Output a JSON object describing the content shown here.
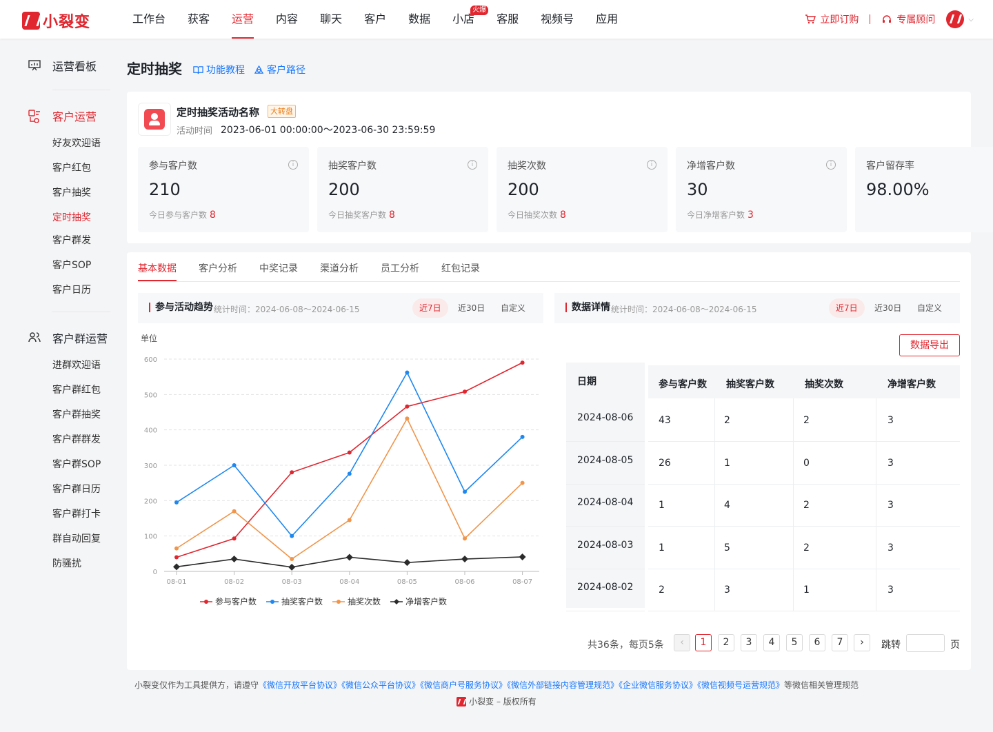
{
  "app": {
    "logo_text": "小裂变"
  },
  "nav": {
    "items": [
      {
        "label": "工作台"
      },
      {
        "label": "获客"
      },
      {
        "label": "运营",
        "active": true
      },
      {
        "label": "内容"
      },
      {
        "label": "聊天"
      },
      {
        "label": "客户"
      },
      {
        "label": "数据"
      },
      {
        "label": "小店",
        "badge": "火爆"
      },
      {
        "label": "客服"
      },
      {
        "label": "视频号"
      },
      {
        "label": "应用"
      }
    ]
  },
  "top_right": {
    "order_label": "立即订购",
    "advisor_label": "专属顾问"
  },
  "sidebar": {
    "board_label": "运营看板",
    "customer_ops": {
      "label": "客户运营",
      "items": [
        "好友欢迎语",
        "客户红包",
        "客户抽奖",
        "定时抽奖",
        "客户群发",
        "客户SOP",
        "客户日历"
      ]
    },
    "group_ops": {
      "label": "客户群运营",
      "items": [
        "进群欢迎语",
        "客户群红包",
        "客户群抽奖",
        "客户群群发",
        "客户群SOP",
        "客户群日历",
        "客户群打卡",
        "群自动回复",
        "防骚扰"
      ]
    }
  },
  "page": {
    "title": "定时抽奖",
    "tutorial_label": "功能教程",
    "path_label": "客户路径"
  },
  "activity": {
    "name": "定时抽奖活动名称",
    "tag": "大转盘",
    "time_label": "活动时间",
    "time_range": "2023-06-01 00:00:00～2023-06-30 23:59:59"
  },
  "stats": [
    {
      "label": "参与客户数",
      "value": "210",
      "sub_label": "今日参与客户数",
      "sub_value": "8",
      "info": true
    },
    {
      "label": "抽奖客户数",
      "value": "200",
      "sub_label": "今日抽奖客户数",
      "sub_value": "8",
      "info": true
    },
    {
      "label": "抽奖次数",
      "value": "200",
      "sub_label": "今日抽奖次数",
      "sub_value": "8",
      "info": true
    },
    {
      "label": "净增客户数",
      "value": "30",
      "sub_label": "今日净增客户数",
      "sub_value": "3",
      "info": true
    },
    {
      "label": "客户留存率",
      "value": "98.00%",
      "sub_label": "",
      "sub_value": "",
      "info": false
    }
  ],
  "tabs": [
    "基本数据",
    "客户分析",
    "中奖记录",
    "渠道分析",
    "员工分析",
    "红包记录"
  ],
  "trend_section": {
    "title": "参与活动趋势",
    "time_text": "统计时间：2024-06-08～2024-06-15",
    "ranges": [
      "近7日",
      "近30日",
      "自定义"
    ],
    "unit_label": "单位"
  },
  "detail_section": {
    "title": "数据详情",
    "time_text": "统计时间：2024-06-08～2024-06-15",
    "ranges": [
      "近7日",
      "近30日",
      "自定义"
    ],
    "export_label": "数据导出"
  },
  "chart_data": {
    "type": "line",
    "x": [
      "08-01",
      "08-02",
      "08-03",
      "08-04",
      "08-05",
      "08-06",
      "08-07"
    ],
    "ylim": [
      0,
      600
    ],
    "yticks": [
      0,
      100,
      200,
      300,
      400,
      500,
      600
    ],
    "grid": true,
    "legend": "bottom",
    "ylabel": "单位",
    "series": [
      {
        "name": "参与客户数",
        "color": "#e0262f",
        "marker": "circle",
        "values": [
          40,
          93,
          280,
          336,
          466,
          508,
          590
        ]
      },
      {
        "name": "抽奖客户数",
        "color": "#1e88f0",
        "marker": "circle",
        "values": [
          195,
          300,
          100,
          276,
          562,
          225,
          380
        ]
      },
      {
        "name": "抽奖次数",
        "color": "#f0954a",
        "marker": "circle",
        "values": [
          65,
          170,
          35,
          145,
          432,
          93,
          250
        ]
      },
      {
        "name": "净增客户数",
        "color": "#2b2b2b",
        "marker": "diamond",
        "values": [
          13,
          35,
          12,
          40,
          25,
          35,
          41
        ]
      }
    ]
  },
  "table": {
    "headers": [
      "日期",
      "参与客户数",
      "抽奖客户数",
      "抽奖次数",
      "净增客户数"
    ],
    "rows": [
      [
        "2024-08-06",
        "43",
        "2",
        "2",
        "3"
      ],
      [
        "2024-08-05",
        "26",
        "1",
        "0",
        "3"
      ],
      [
        "2024-08-04",
        "1",
        "4",
        "2",
        "3"
      ],
      [
        "2024-08-03",
        "1",
        "5",
        "2",
        "3"
      ],
      [
        "2024-08-02",
        "2",
        "3",
        "1",
        "3"
      ]
    ]
  },
  "pagination": {
    "total_text": "共36条，每页5条",
    "pages": [
      "1",
      "2",
      "3",
      "4",
      "5",
      "6",
      "7"
    ],
    "current": "1",
    "jump_label": "跳转",
    "page_unit": "页"
  },
  "footer": {
    "prefix": "小裂变仅作为工具提供方，请遵守",
    "links": [
      "《微信开放平台协议》",
      "《微信公众平台协议》",
      "《微信商户号服务协议》",
      "《微信外部链接内容管理规范》",
      "《企业微信服务协议》",
      "《微信视频号运营规范》"
    ],
    "suffix": "等微信相关管理规范",
    "copyright": "小裂变 – 版权所有"
  }
}
